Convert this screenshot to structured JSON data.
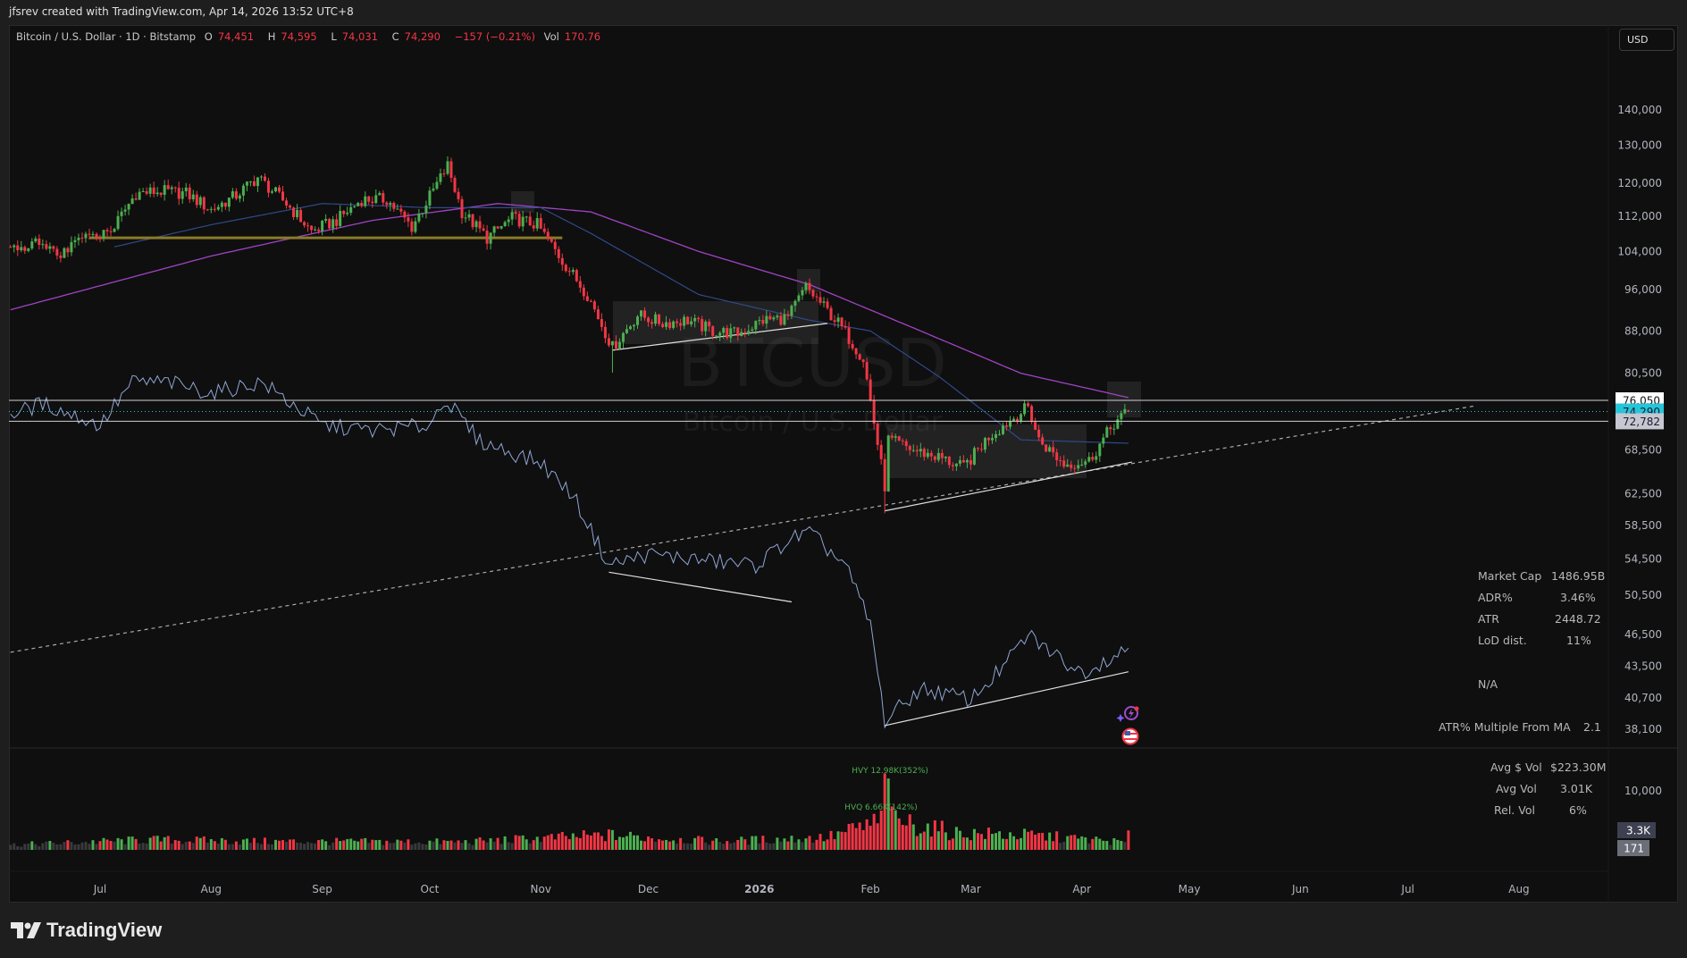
{
  "header": {
    "created_by": "jfsrev created with TradingView.com, Apr 14, 2026 13:52 UTC+8",
    "symbol": "Bitcoin / U.S. Dollar · 1D · Bitstamp",
    "o_label": "O",
    "o_value": "74,451",
    "h_label": "H",
    "h_value": "74,595",
    "l_label": "L",
    "l_value": "74,031",
    "c_label": "C",
    "c_value": "74,290",
    "change": "−157 (−0.21%)",
    "vol_label": "Vol",
    "vol_value": "170.76"
  },
  "currency_button": "USD",
  "watermark": {
    "ticker": "BTCUSD",
    "name": "Bitcoin / U.S. Dollar"
  },
  "stats": {
    "market_cap_label": "Market Cap",
    "market_cap": "1486.95B",
    "adr_label": "ADR%",
    "adr": "3.46%",
    "atr_label": "ATR",
    "atr": "2448.72",
    "lod_label": "LoD dist.",
    "lod": "11%",
    "na": "N/A",
    "atr_mult_label": "ATR% Multiple From MA",
    "atr_mult": "2.1",
    "avg_dollar_vol_label": "Avg $ Vol",
    "avg_dollar_vol": "$223.30M",
    "avg_vol_label": "Avg Vol",
    "avg_vol": "3.01K",
    "rel_vol_label": "Rel. Vol",
    "rel_vol": "6%"
  },
  "brand": "TradingView",
  "colors": {
    "up": "#4caf50",
    "down": "#f23645",
    "neutral_vol": "#3a3a3e",
    "ma_long": "#a243c7",
    "ma_short": "#2f4a8a",
    "compare": "#8fa6d4",
    "last_price": "#26c6da"
  },
  "chart_data": {
    "type": "candlestick",
    "title": "Bitcoin / U.S. Dollar · 1D · Bitstamp",
    "y_scale": "log",
    "ylim": [
      38100,
      140000
    ],
    "y_ticks": [
      "140,000",
      "130,000",
      "120,000",
      "112,000",
      "104,000",
      "96,000",
      "88,000",
      "80,500",
      "68,500",
      "62,500",
      "58,500",
      "54,500",
      "50,500",
      "46,500",
      "43,500",
      "40,700",
      "38,100"
    ],
    "y_tick_values": [
      140000,
      130000,
      120000,
      112000,
      104000,
      96000,
      88000,
      80500,
      68500,
      62500,
      58500,
      54500,
      50500,
      46500,
      43500,
      40700,
      38100
    ],
    "price_labels": [
      {
        "text": "76,050",
        "value": 76050,
        "style": "white"
      },
      {
        "text": "74,290",
        "value": 74290,
        "style": "last"
      },
      {
        "text": "72,782",
        "value": 72782,
        "style": "gray"
      }
    ],
    "x_ticks": [
      {
        "label": "Jul",
        "date": "2025-07-01"
      },
      {
        "label": "Aug",
        "date": "2025-08-01"
      },
      {
        "label": "Sep",
        "date": "2025-09-01"
      },
      {
        "label": "Oct",
        "date": "2025-10-01"
      },
      {
        "label": "Nov",
        "date": "2025-11-01"
      },
      {
        "label": "Dec",
        "date": "2025-12-01"
      },
      {
        "label": "2026",
        "date": "2026-01-01"
      },
      {
        "label": "Feb",
        "date": "2026-02-01"
      },
      {
        "label": "Mar",
        "date": "2026-03-01"
      },
      {
        "label": "Apr",
        "date": "2026-04-01"
      },
      {
        "label": "May",
        "date": "2026-05-01"
      },
      {
        "label": "Jun",
        "date": "2026-06-01"
      },
      {
        "label": "Jul",
        "date": "2026-07-01"
      },
      {
        "label": "Aug",
        "date": "2026-08-01"
      }
    ],
    "close_keypoints": [
      [
        "2025-06-06",
        105000
      ],
      [
        "2025-06-13",
        105500
      ],
      [
        "2025-06-20",
        103500
      ],
      [
        "2025-06-27",
        107000
      ],
      [
        "2025-07-04",
        108500
      ],
      [
        "2025-07-11",
        117500
      ],
      [
        "2025-07-18",
        118000
      ],
      [
        "2025-07-25",
        117500
      ],
      [
        "2025-08-01",
        113500
      ],
      [
        "2025-08-08",
        117000
      ],
      [
        "2025-08-14",
        121500
      ],
      [
        "2025-08-22",
        115000
      ],
      [
        "2025-08-29",
        108500
      ],
      [
        "2025-09-05",
        111000
      ],
      [
        "2025-09-12",
        116000
      ],
      [
        "2025-09-19",
        116000
      ],
      [
        "2025-09-26",
        109500
      ],
      [
        "2025-10-06",
        124500
      ],
      [
        "2025-10-10",
        113000
      ],
      [
        "2025-10-17",
        107000
      ],
      [
        "2025-10-24",
        111500
      ],
      [
        "2025-10-31",
        110000
      ],
      [
        "2025-11-07",
        102000
      ],
      [
        "2025-11-14",
        95000
      ],
      [
        "2025-11-21",
        85000
      ],
      [
        "2025-11-28",
        91000
      ],
      [
        "2025-12-05",
        89500
      ],
      [
        "2025-12-12",
        90000
      ],
      [
        "2025-12-19",
        88000
      ],
      [
        "2025-12-26",
        87500
      ],
      [
        "2026-01-02",
        90000
      ],
      [
        "2026-01-09",
        90500
      ],
      [
        "2026-01-14",
        96500
      ],
      [
        "2026-01-23",
        89500
      ],
      [
        "2026-01-30",
        83000
      ],
      [
        "2026-02-05",
        63500
      ],
      [
        "2026-02-06",
        70000
      ],
      [
        "2026-02-13",
        68500
      ],
      [
        "2026-02-20",
        67500
      ],
      [
        "2026-02-27",
        66000
      ],
      [
        "2026-03-06",
        70500
      ],
      [
        "2026-03-17",
        75000
      ],
      [
        "2026-03-20",
        70000
      ],
      [
        "2026-03-27",
        66500
      ],
      [
        "2026-04-03",
        67000
      ],
      [
        "2026-04-10",
        72500
      ],
      [
        "2026-04-14",
        74290
      ]
    ],
    "ma_long": [
      [
        "2025-06-06",
        92000
      ],
      [
        "2025-08-01",
        103000
      ],
      [
        "2025-09-15",
        111000
      ],
      [
        "2025-10-20",
        115000
      ],
      [
        "2025-11-15",
        113000
      ],
      [
        "2025-12-15",
        104000
      ],
      [
        "2026-01-15",
        97000
      ],
      [
        "2026-02-15",
        88000
      ],
      [
        "2026-03-15",
        80500
      ],
      [
        "2026-04-14",
        76500
      ]
    ],
    "ma_short": [
      [
        "2025-07-05",
        105000
      ],
      [
        "2025-08-01",
        110000
      ],
      [
        "2025-09-01",
        115000
      ],
      [
        "2025-10-01",
        114000
      ],
      [
        "2025-11-01",
        114000
      ],
      [
        "2025-11-15",
        108000
      ],
      [
        "2025-12-15",
        95000
      ],
      [
        "2026-01-15",
        90000
      ],
      [
        "2026-02-01",
        88000
      ],
      [
        "2026-02-20",
        80000
      ],
      [
        "2026-03-15",
        70000
      ],
      [
        "2026-04-14",
        69500
      ]
    ],
    "compare_line": [
      [
        "2025-06-06",
        73860
      ],
      [
        "2025-06-15",
        75530
      ],
      [
        "2025-07-01",
        72180
      ],
      [
        "2025-07-10",
        79020
      ],
      [
        "2025-07-20",
        79020
      ],
      [
        "2025-08-01",
        77250
      ],
      [
        "2025-08-15",
        79020
      ],
      [
        "2025-09-01",
        72180
      ],
      [
        "2025-09-15",
        71380
      ],
      [
        "2025-10-01",
        72180
      ],
      [
        "2025-10-05",
        76380
      ],
      [
        "2025-10-15",
        69790
      ],
      [
        "2025-11-01",
        66690
      ],
      [
        "2025-11-10",
        62320
      ],
      [
        "2025-11-20",
        53800
      ],
      [
        "2025-12-01",
        55040
      ],
      [
        "2025-12-15",
        54420
      ],
      [
        "2025-12-31",
        53800
      ],
      [
        "2026-01-10",
        56930
      ],
      [
        "2026-01-15",
        57580
      ],
      [
        "2026-01-25",
        53800
      ],
      [
        "2026-02-01",
        47530
      ],
      [
        "2026-02-05",
        38790
      ],
      [
        "2026-02-15",
        41510
      ],
      [
        "2026-03-01",
        40580
      ],
      [
        "2026-03-10",
        43430
      ],
      [
        "2026-03-17",
        46470
      ],
      [
        "2026-03-25",
        44430
      ],
      [
        "2026-04-01",
        42940
      ],
      [
        "2026-04-14",
        45230
      ]
    ],
    "volume": {
      "axis_ticks": [
        "10,000"
      ],
      "axis_tick_values": [
        10000
      ],
      "labels": [
        {
          "text": "3.3K",
          "value": 3300
        },
        {
          "text": "171",
          "value": 171
        }
      ],
      "annotations": [
        {
          "text": "HVY 12.98K(352%)",
          "date": "2026-02-05",
          "value": 12980
        },
        {
          "text": "HVQ 6.66K(142%)",
          "date": "2026-02-04",
          "value": 6660
        }
      ],
      "base_keypoints": [
        [
          "2025-06-06",
          900
        ],
        [
          "2025-07-15",
          1800
        ],
        [
          "2025-08-15",
          1500
        ],
        [
          "2025-10-10",
          1400
        ],
        [
          "2025-11-20",
          2600
        ],
        [
          "2025-12-20",
          1500
        ],
        [
          "2026-01-20",
          2200
        ],
        [
          "2026-02-06",
          5500
        ],
        [
          "2026-02-25",
          3000
        ],
        [
          "2026-03-20",
          2500
        ],
        [
          "2026-04-14",
          1300
        ]
      ]
    },
    "trendlines": [
      {
        "name": "dashed-support",
        "from": [
          "2025-06-06",
          44800
        ],
        "to": [
          "2026-07-20",
          75200
        ]
      },
      {
        "name": "range-low-nov",
        "from": [
          "2025-11-21",
          84500
        ],
        "to": [
          "2026-01-20",
          89400
        ]
      },
      {
        "name": "range-low-feb",
        "from": [
          "2026-02-05",
          60300
        ],
        "to": [
          "2026-04-15",
          66800
        ]
      },
      {
        "name": "compare-low-nov",
        "from": [
          "2025-11-20",
          53000
        ],
        "to": [
          "2026-01-10",
          49800
        ]
      },
      {
        "name": "compare-low-feb",
        "from": [
          "2026-02-05",
          38400
        ],
        "to": [
          "2026-04-14",
          43000
        ]
      },
      {
        "name": "support-level",
        "from": [
          "2025-06-28",
          107000
        ],
        "to": [
          "2025-11-07",
          107000
        ]
      }
    ]
  }
}
